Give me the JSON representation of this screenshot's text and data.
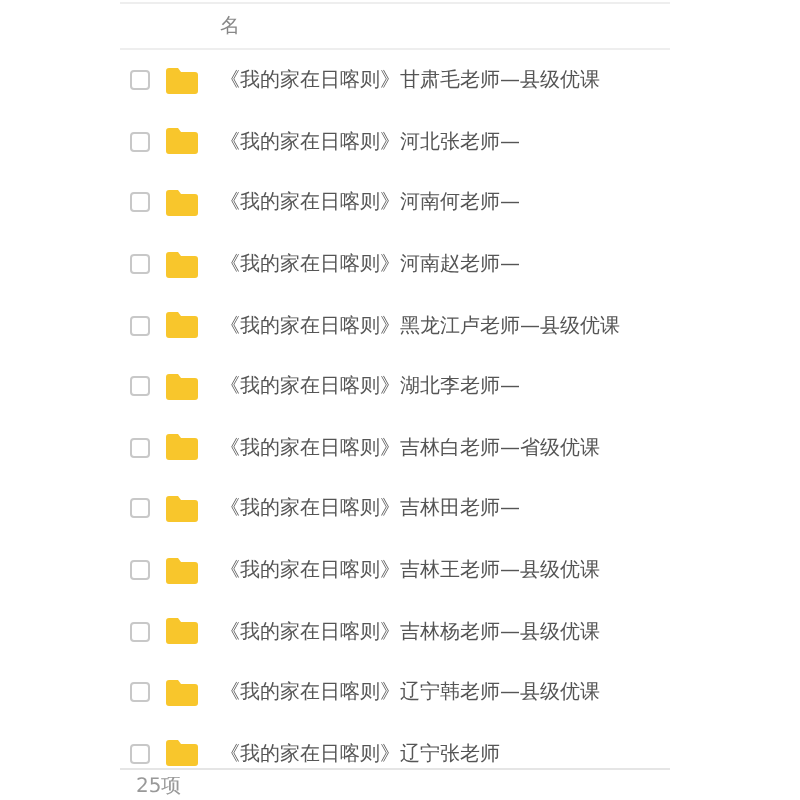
{
  "header": {
    "column_label": "名"
  },
  "rows": [
    {
      "name": "《我的家在日喀则》甘肃毛老师—县级优课",
      "checked": false
    },
    {
      "name": "《我的家在日喀则》河北张老师—",
      "checked": false
    },
    {
      "name": "《我的家在日喀则》河南何老师—",
      "checked": false
    },
    {
      "name": "《我的家在日喀则》河南赵老师—",
      "checked": false
    },
    {
      "name": "《我的家在日喀则》黑龙江卢老师—县级优课",
      "checked": false
    },
    {
      "name": "《我的家在日喀则》湖北李老师—",
      "checked": false
    },
    {
      "name": "《我的家在日喀则》吉林白老师—省级优课",
      "checked": false
    },
    {
      "name": "《我的家在日喀则》吉林田老师—",
      "checked": false
    },
    {
      "name": "《我的家在日喀则》吉林王老师—县级优课",
      "checked": false
    },
    {
      "name": "《我的家在日喀则》吉林杨老师—县级优课",
      "checked": false
    },
    {
      "name": "《我的家在日喀则》辽宁韩老师—县级优课",
      "checked": false
    },
    {
      "name": "《我的家在日喀则》辽宁张老师",
      "checked": false
    }
  ],
  "footer": {
    "count": "25项"
  }
}
